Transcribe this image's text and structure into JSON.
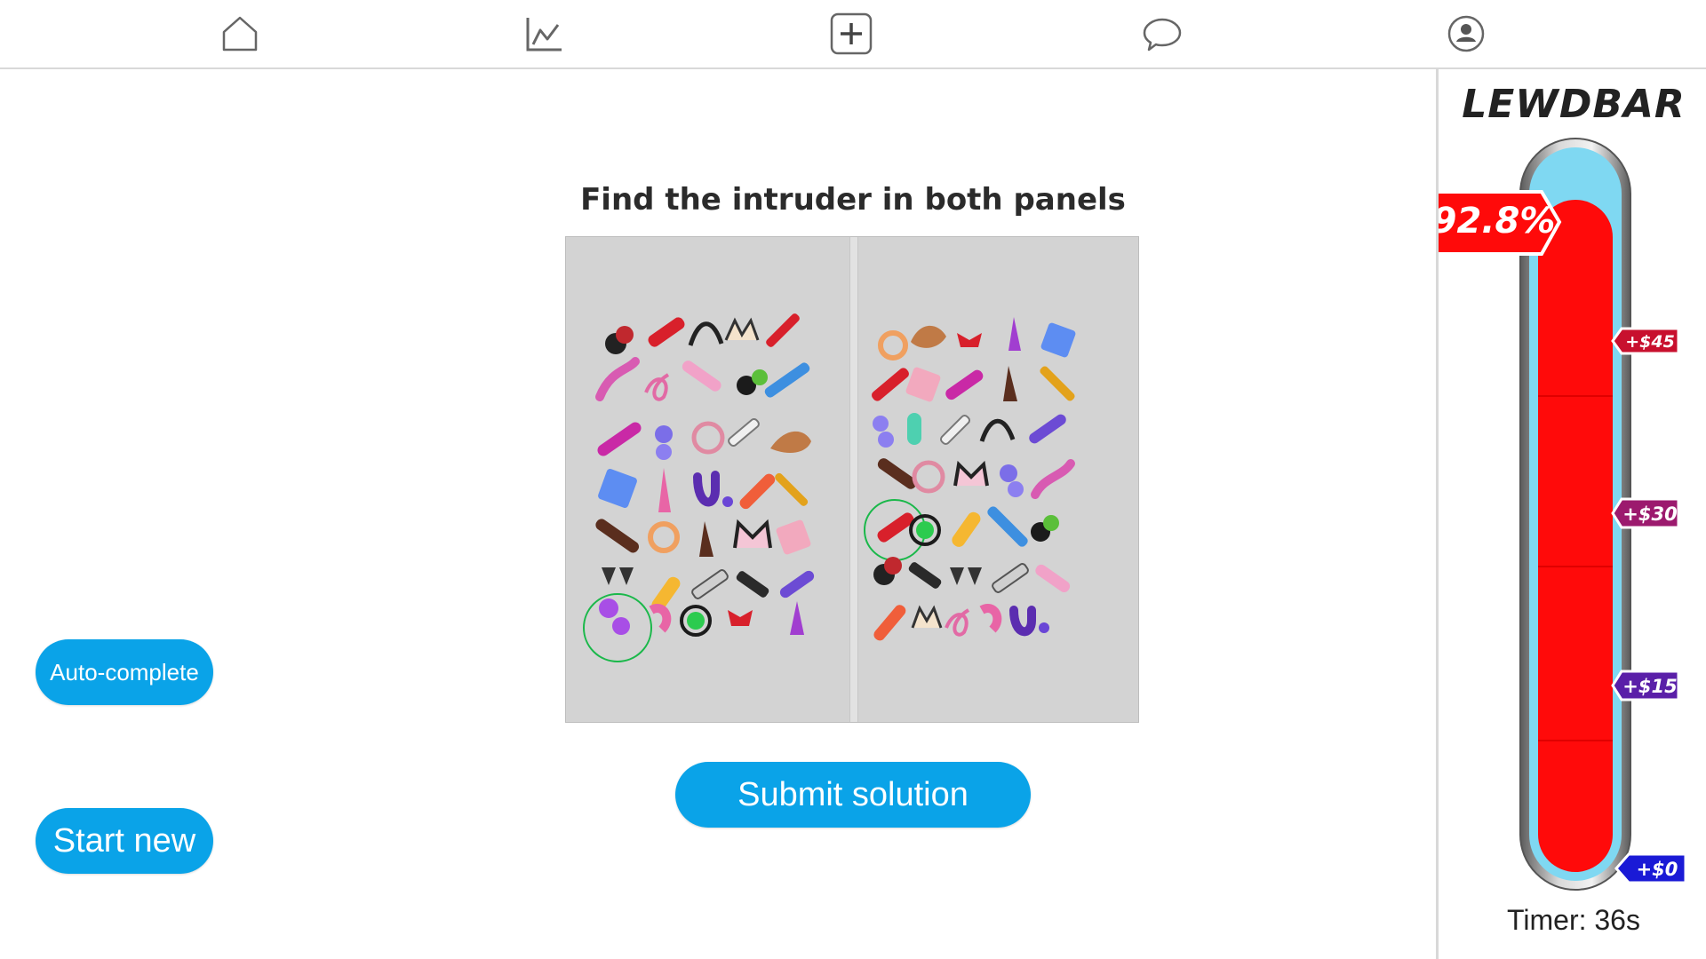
{
  "nav": {
    "items": [
      {
        "name": "home",
        "icon": "home-icon"
      },
      {
        "name": "stats",
        "icon": "chart-icon"
      },
      {
        "name": "create",
        "icon": "plus-square-icon"
      },
      {
        "name": "chat",
        "icon": "speech-bubble-icon"
      },
      {
        "name": "profile",
        "icon": "user-circle-icon"
      }
    ]
  },
  "puzzle": {
    "title": "Find the intruder in both panels",
    "submit_label": "Submit solution"
  },
  "actions": {
    "auto_complete_label": "Auto-complete",
    "start_new_label": "Start new"
  },
  "lewdbar": {
    "title": "LEWDBAR",
    "percent_label": "92.8%",
    "fill_fraction": 0.928,
    "rewards": [
      {
        "label": "+$45",
        "color": "#c8102e"
      },
      {
        "label": "+$30",
        "color": "#9c1a6e"
      },
      {
        "label": "+$15",
        "color": "#5a1fa8"
      },
      {
        "label": "+$0",
        "color": "#1a1ad6"
      }
    ],
    "timer_label": "Timer: 36s"
  },
  "colors": {
    "accent": "#0aa3e8",
    "bar_fill": "#ff0a0a",
    "bar_tube": "#7fd8f2"
  }
}
